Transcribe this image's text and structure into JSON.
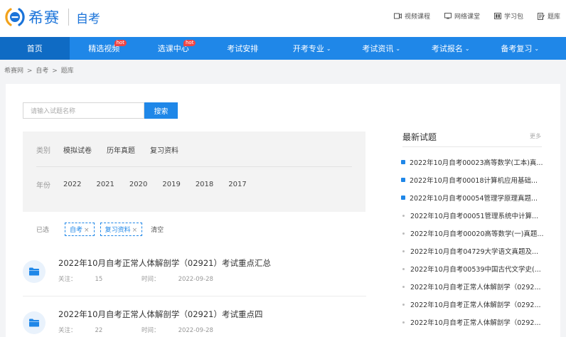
{
  "header": {
    "logo_text": "希赛",
    "subtitle": "自考",
    "links": [
      {
        "label": "视频课程",
        "icon": "video-icon"
      },
      {
        "label": "网络课堂",
        "icon": "classroom-icon"
      },
      {
        "label": "学习包",
        "icon": "package-icon"
      },
      {
        "label": "题库",
        "icon": "question-bank-icon"
      }
    ]
  },
  "nav": {
    "items": [
      {
        "label": "首页",
        "active": true
      },
      {
        "label": "精选视频",
        "badge": "hot"
      },
      {
        "label": "选课中心",
        "badge": "hot"
      },
      {
        "label": "考试安排"
      },
      {
        "label": "开考专业",
        "dropdown": true
      },
      {
        "label": "考试资讯",
        "dropdown": true
      },
      {
        "label": "考试报名",
        "dropdown": true
      },
      {
        "label": "备考复习",
        "dropdown": true
      }
    ]
  },
  "breadcrumb": [
    "希赛网",
    ">",
    "自考",
    ">",
    "题库"
  ],
  "search": {
    "placeholder": "请输入试题名称",
    "button": "搜索"
  },
  "filters": {
    "category": {
      "label": "类别",
      "options": [
        "模拟试卷",
        "历年真题",
        "复习资料"
      ]
    },
    "year": {
      "label": "年份",
      "options": [
        "2022",
        "2021",
        "2020",
        "2019",
        "2018",
        "2017"
      ]
    }
  },
  "selected": {
    "label": "已选",
    "tags": [
      "自考",
      "复习资料"
    ],
    "remove": "×",
    "clear": "清空"
  },
  "list": [
    {
      "title": "2022年10月自考正常人体解剖学（02921）考试重点汇总",
      "follow_label": "关注：",
      "follow": "15",
      "time_label": "时间：",
      "time": "2022-09-28"
    },
    {
      "title": "2022年10月自考正常人体解剖学（02921）考试重点四",
      "follow_label": "关注：",
      "follow": "22",
      "time_label": "时间：",
      "time": "2022-09-28"
    }
  ],
  "sidebar": {
    "title": "最新试题",
    "more": "更多",
    "items": [
      {
        "text": "2022年10月自考00023高等数学(工本)真...",
        "bullet": "blue"
      },
      {
        "text": "2022年10月自考00018计算机应用基础...",
        "bullet": "blue"
      },
      {
        "text": "2022年10月自考00054管理学原理真题...",
        "bullet": "blue"
      },
      {
        "text": "2022年10月自考00051管理系统中计算...",
        "bullet": "dot"
      },
      {
        "text": "2022年10月自考00020高等数学(一)真题...",
        "bullet": "dot"
      },
      {
        "text": "2022年10月自考04729大学语文真题及...",
        "bullet": "dot"
      },
      {
        "text": "2022年10月自考00539中国古代文学史(...",
        "bullet": "dot"
      },
      {
        "text": "2022年10月自考正常人体解剖学（0292...",
        "bullet": "dot"
      },
      {
        "text": "2022年10月自考正常人体解剖学（0292...",
        "bullet": "dot"
      },
      {
        "text": "2022年10月自考正常人体解剖学（0292...",
        "bullet": "dot"
      }
    ]
  },
  "colors": {
    "brand": "#1f87e8",
    "nav_active": "#0f6bc4",
    "hot": "#f04545"
  }
}
